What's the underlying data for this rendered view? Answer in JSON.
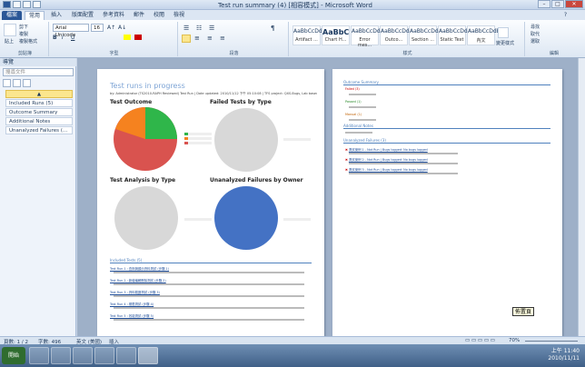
{
  "window": {
    "title": "Test run summary (4) [相容模式] - Microsoft Word"
  },
  "tabs": [
    "檔案",
    "常用",
    "插入",
    "版面配置",
    "參考資料",
    "郵件",
    "校閱",
    "檢視"
  ],
  "ribbon": {
    "clipboard": {
      "paste": "貼上",
      "cut": "剪下",
      "copy": "複製",
      "format_painter": "複製格式",
      "label": "剪貼簿"
    },
    "font": {
      "name": "Arial Unicode",
      "size": "16",
      "label": "字型"
    },
    "paragraph": {
      "label": "段落"
    },
    "styles": {
      "items": [
        {
          "preview": "AaBbCcDdE",
          "name": "Artifact ..."
        },
        {
          "preview": "AaBbC",
          "name": "Chart H..."
        },
        {
          "preview": "AaBbCcDdE",
          "name": "Error mes..."
        },
        {
          "preview": "AaBbCcDdE",
          "name": "Outco..."
        },
        {
          "preview": "AaBbCcDd",
          "name": "Section ..."
        },
        {
          "preview": "AaBbCcDd",
          "name": "Static Text"
        },
        {
          "preview": "AaBbCcDdE",
          "name": "內文"
        }
      ],
      "change_styles": "變更樣式",
      "label": "樣式"
    },
    "editing": {
      "find": "尋找",
      "replace": "取代",
      "select": "選取",
      "label": "編輯"
    }
  },
  "nav": {
    "title": "導覽",
    "search_placeholder": "搜尋文件",
    "top_item": "",
    "items": [
      "Included Runs (5)",
      "Outcome Summary",
      "Additional Notes",
      "Unanalyzed Failures (..."
    ]
  },
  "page1": {
    "heading": "Test runs in progress",
    "byline": "by: Administrator (TS2010-RAPH Reviewed) Test Run | Date updated: 2010/11/12 下午 05:10:08 | TFS project: QXS-Bugs, Lab based: 0 | Unit based: 5 | Total: 5",
    "charts": [
      {
        "title": "Test Outcome"
      },
      {
        "title": "Failed Tests by Type"
      },
      {
        "title": "Test Analysis by Type"
      },
      {
        "title": "Unanalyzed Failures by Owner"
      }
    ],
    "section": "Included Tests (5)",
    "rows": [
      "Test Run 1 : 查詢與顯示資料測試 (步驟 1)",
      "Test Run 2 : 新增編輯刪除測試 (步驟 2)",
      "Test Run 3 : 資料驗證測試 (步驟 3)",
      "Test Run 4 : 權限測試 (步驟 4)",
      "Test Run 5 : 效能測試 (步驟 5)"
    ]
  },
  "page2": {
    "section1": "Outcome Summary",
    "outcomes": [
      "Failed (3)",
      "Passed (1)",
      "Manual (1)"
    ],
    "section2": "Additional Notes",
    "section3": "Unanalyzed Failures (3)",
    "failures": [
      "測試案例 1 - Not Run | Bugs logged: No bugs logged",
      "測試案例 2 - Not Run | Bugs logged: No bugs logged",
      "測試案例 3 - Not Run | Bugs logged: No bugs logged"
    ]
  },
  "tooltip": "佈置頁",
  "statusbar": {
    "page": "頁數: 1 / 2",
    "words": "字數: 496",
    "language": "英文 (美國)",
    "mode": "插入",
    "zoom": "70%"
  },
  "taskbar": {
    "start": "開始",
    "time": "上午 11:40",
    "date": "2010/11/11"
  }
}
